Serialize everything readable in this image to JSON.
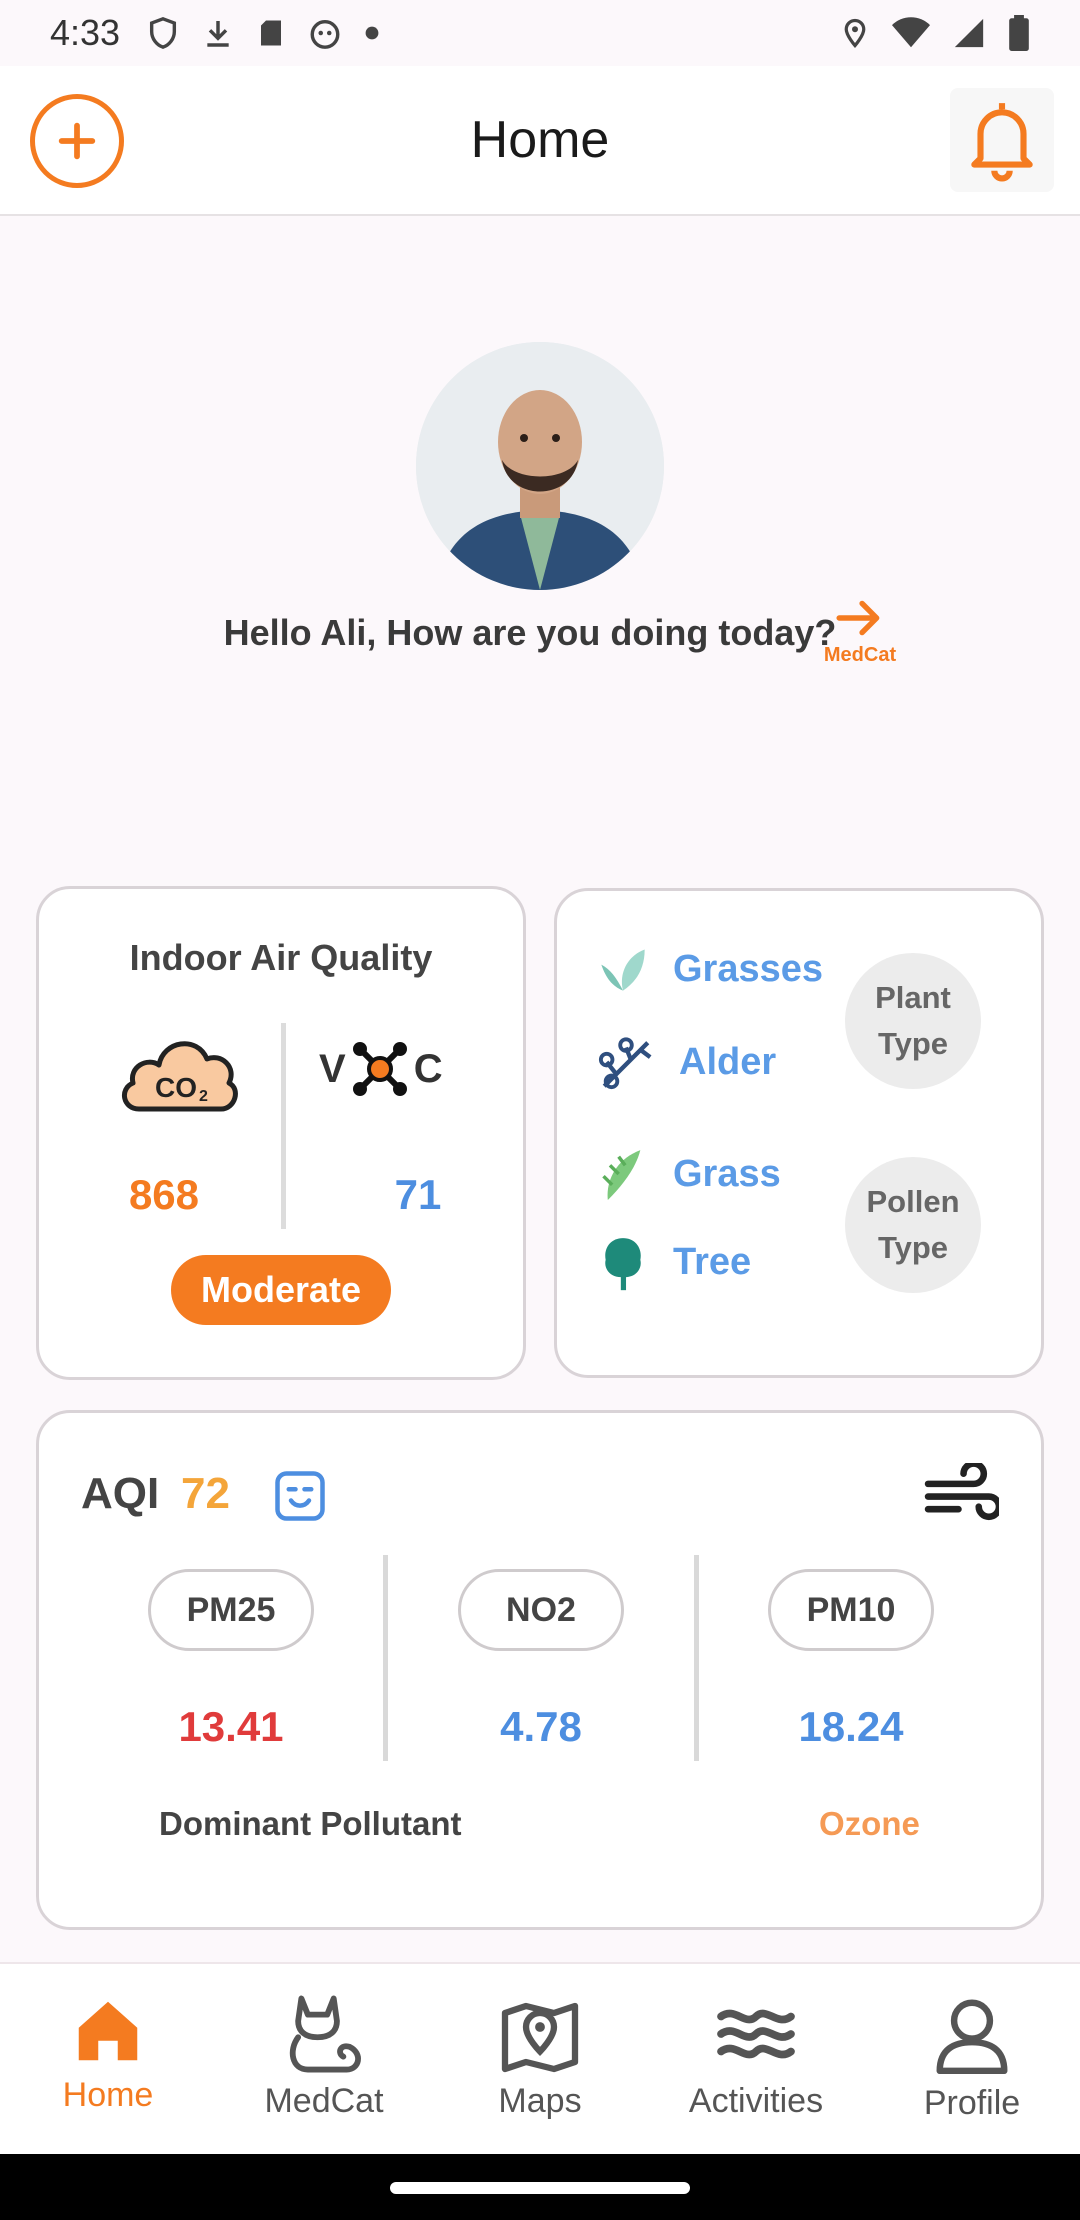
{
  "status_bar": {
    "time": "4:33"
  },
  "header": {
    "title": "Home",
    "add_icon": "plus-circle-icon",
    "bell_icon": "bell-icon"
  },
  "greeting": {
    "text": "Hello Ali, How are you doing today?",
    "link_label": "MedCat"
  },
  "indoor_air_quality": {
    "title": "Indoor Air Quality",
    "co2_value": "868",
    "voc_left": "V",
    "voc_right": "C",
    "voc_value": "71",
    "status_label": "Moderate"
  },
  "plant_pollen": {
    "plant_items": [
      "Grasses",
      "Alder"
    ],
    "plant_type_label": [
      "Plant",
      "Type"
    ],
    "pollen_items": [
      "Grass",
      "Tree"
    ],
    "pollen_type_label": [
      "Pollen",
      "Type"
    ]
  },
  "aqi": {
    "label": "AQI",
    "value": "72",
    "pollutants": [
      {
        "name": "PM25",
        "value": "13.41",
        "color": "#e03b3b"
      },
      {
        "name": "NO2",
        "value": "4.78",
        "color": "#4d8ee0"
      },
      {
        "name": "PM10",
        "value": "18.24",
        "color": "#4d8ee0"
      }
    ],
    "dominant_label": "Dominant Pollutant",
    "dominant_value": "Ozone"
  },
  "bottom_nav": {
    "items": [
      {
        "label": "Home",
        "icon": "home-icon",
        "active": true
      },
      {
        "label": "MedCat",
        "icon": "cat-icon",
        "active": false
      },
      {
        "label": "Maps",
        "icon": "map-pin-icon",
        "active": false
      },
      {
        "label": "Activities",
        "icon": "waves-icon",
        "active": false
      },
      {
        "label": "Profile",
        "icon": "user-icon",
        "active": false
      }
    ]
  },
  "colors": {
    "accent": "#f47b20",
    "blue": "#4d8ee0",
    "red": "#e03b3b",
    "aqi_orange": "#f4a53a"
  }
}
